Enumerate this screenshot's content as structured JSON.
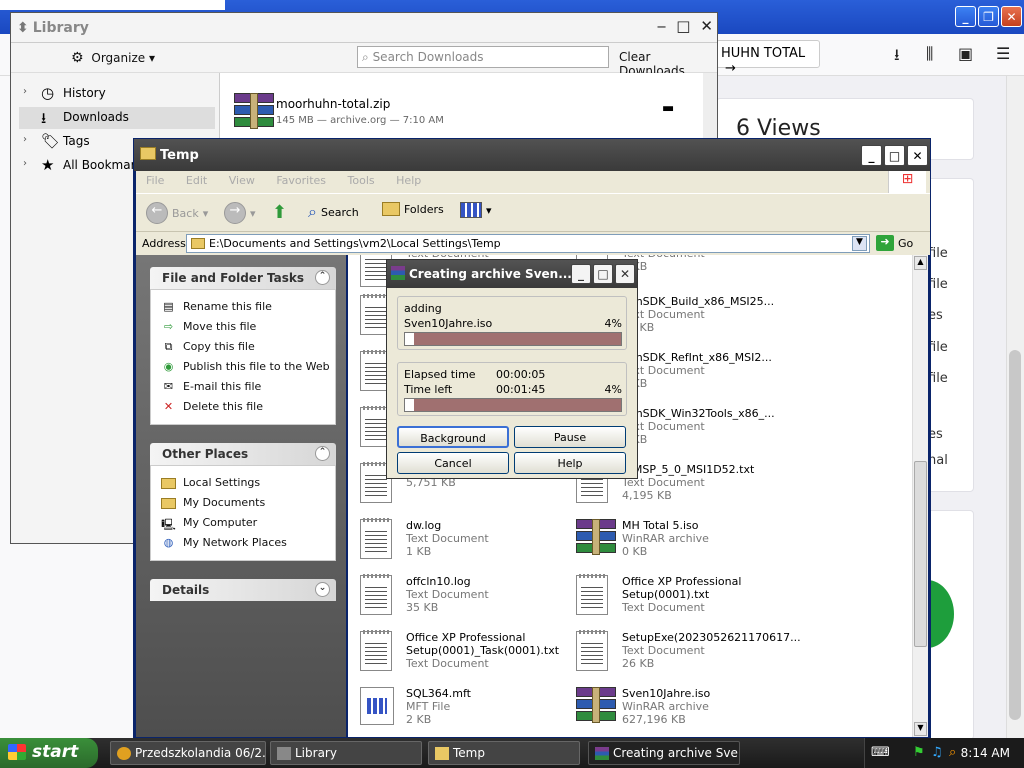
{
  "browser": {
    "pill_text": "HUHN TOTAL",
    "views_text": "6 Views",
    "side_labels": [
      "file",
      "file",
      "es",
      "file",
      "file",
      "es",
      "nal"
    ]
  },
  "library": {
    "title": "Library",
    "organize_label": "Organize",
    "search_placeholder": "Search Downloads",
    "clear_label": "Clear Downloads",
    "tree": [
      {
        "label": "History",
        "icon": "clock-icon"
      },
      {
        "label": "Downloads",
        "icon": "download-icon"
      },
      {
        "label": "Tags",
        "icon": "tag-icon"
      },
      {
        "label": "All Bookmarks",
        "icon": "star-icon"
      }
    ],
    "download": {
      "name": "moorhuhn-total.zip",
      "meta": "145 MB — archive.org — 7:10 AM"
    }
  },
  "temp": {
    "title": "Temp",
    "menu": [
      "File",
      "Edit",
      "View",
      "Favorites",
      "Tools",
      "Help"
    ],
    "toolbar": {
      "back": "Back",
      "search": "Search",
      "folders": "Folders"
    },
    "address_label": "Address",
    "address": "E:\\Documents and Settings\\vm2\\Local Settings\\Temp",
    "go_label": "Go",
    "tasks_panel": {
      "title": "File and Folder Tasks",
      "items": [
        "Rename this file",
        "Move this file",
        "Copy this file",
        "Publish this file to the Web",
        "E-mail this file",
        "Delete this file"
      ]
    },
    "places_panel": {
      "title": "Other Places",
      "items": [
        "Local Settings",
        "My Documents",
        "My Computer",
        "My Network Places"
      ]
    },
    "details_panel": {
      "title": "Details"
    },
    "files": [
      {
        "name": "",
        "type": "Text Document",
        "size": "",
        "icon": "text",
        "col": 0,
        "row": 0
      },
      {
        "name": "",
        "type": "Text Document",
        "size": "1 KB",
        "icon": "text",
        "col": 1,
        "row": 0
      },
      {
        "name": "",
        "type": "",
        "size": "",
        "icon": "text",
        "col": 0,
        "row": 1
      },
      {
        "name": "WinSDK_Build_x86_MSI25...",
        "type": "Text Document",
        "size": "26 KB",
        "icon": "text",
        "col": 1,
        "row": 1
      },
      {
        "name": "",
        "type": "",
        "size": "",
        "icon": "text",
        "col": 0,
        "row": 2
      },
      {
        "name": "WinSDK_RefInt_x86_MSI2...",
        "type": "Text Document",
        "size": "1 KB",
        "icon": "text",
        "col": 1,
        "row": 2
      },
      {
        "name": "",
        "type": "",
        "size": "",
        "icon": "text",
        "col": 0,
        "row": 3
      },
      {
        "name": "WinSDK_Win32Tools_x86_...",
        "type": "Text Document",
        "size": "1 KB",
        "icon": "text",
        "col": 1,
        "row": 3
      },
      {
        "name": "",
        "type": "Text Document",
        "size": "5,751 KB",
        "icon": "text",
        "col": 0,
        "row": 4
      },
      {
        "name": "WMSP_5_0_MSI1D52.txt",
        "type": "Text Document",
        "size": "4,195 KB",
        "icon": "text",
        "col": 1,
        "row": 4
      },
      {
        "name": "dw.log",
        "type": "Text Document",
        "size": "1 KB",
        "icon": "text",
        "col": 0,
        "row": 5
      },
      {
        "name": "MH Total 5.iso",
        "type": "WinRAR archive",
        "size": "0 KB",
        "icon": "rar",
        "col": 1,
        "row": 5
      },
      {
        "name": "offcln10.log",
        "type": "Text Document",
        "size": "35 KB",
        "icon": "text",
        "col": 0,
        "row": 6
      },
      {
        "name": "Office XP Professional Setup(0001).txt",
        "type": "Text Document",
        "size": "",
        "icon": "text",
        "col": 1,
        "row": 6
      },
      {
        "name": "Office XP Professional Setup(0001)_Task(0001).txt",
        "type": "Text Document",
        "size": "",
        "icon": "text",
        "col": 0,
        "row": 7
      },
      {
        "name": "SetupExe(2023052621170617...",
        "type": "Text Document",
        "size": "26 KB",
        "icon": "text",
        "col": 1,
        "row": 7
      },
      {
        "name": "SQL364.mft",
        "type": "MFT File",
        "size": "2 KB",
        "icon": "mft",
        "col": 0,
        "row": 8
      },
      {
        "name": "Sven10Jahre.iso",
        "type": "WinRAR archive",
        "size": "627,196 KB",
        "icon": "rar",
        "col": 1,
        "row": 8
      }
    ]
  },
  "rar": {
    "title": "Creating archive Sven...",
    "action": "adding",
    "filename": "Sven10Jahre.iso",
    "file_pct": "4%",
    "file_progress": 0.04,
    "elapsed_label": "Elapsed time",
    "elapsed": "00:00:05",
    "left_label": "Time left",
    "time_left": "00:01:45",
    "total_pct": "4%",
    "total_progress": 0.04,
    "buttons": {
      "background": "Background",
      "pause": "Pause",
      "cancel": "Cancel",
      "help": "Help"
    }
  },
  "taskbar": {
    "start": "start",
    "tasks": [
      "Przedszkolandia 06/2...",
      "Library",
      "Temp",
      "Creating archive Sve..."
    ],
    "clock": "8:14 AM"
  }
}
